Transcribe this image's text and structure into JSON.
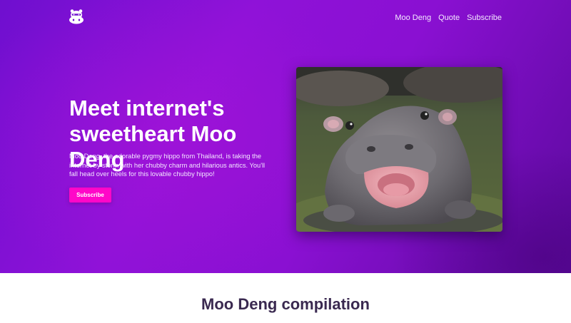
{
  "header": {
    "logo": "hippo-logo-icon",
    "nav": [
      {
        "label": "Moo Deng"
      },
      {
        "label": "Quote"
      },
      {
        "label": "Subscribe"
      }
    ]
  },
  "hero": {
    "headline": "Meet internet's sweetheart Moo Deng",
    "description": "Moo Deng, the adorable pygmy hippo from Thailand, is taking the internet by storm with her chubby charm and hilarious antics. You'll fall head over heels for this lovable chubby hippo!",
    "cta_label": "Subscribe",
    "image": "baby-pygmy-hippo-photo"
  },
  "compilation": {
    "title": "Moo Deng compilation"
  },
  "colors": {
    "hero_gradient_start": "#6f0fcf",
    "hero_gradient_end": "#5c0a9e",
    "cta": "#ff07c8",
    "section_title": "#3a2950"
  }
}
